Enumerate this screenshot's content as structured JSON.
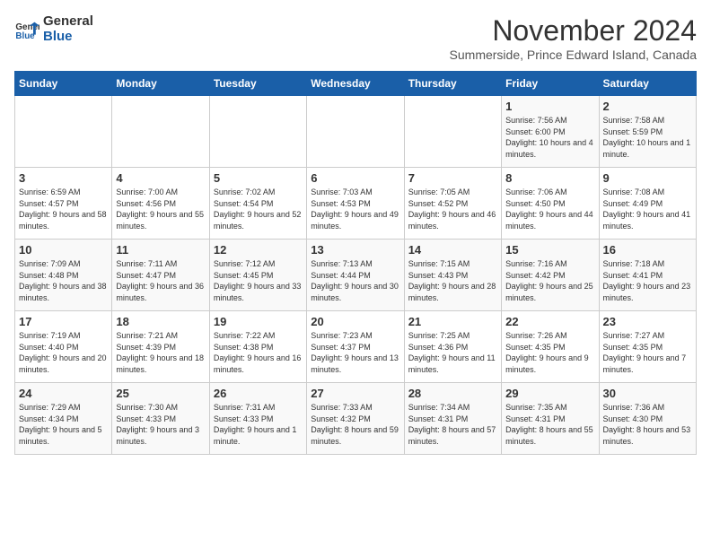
{
  "logo": {
    "line1": "General",
    "line2": "Blue"
  },
  "title": "November 2024",
  "subtitle": "Summerside, Prince Edward Island, Canada",
  "header": {
    "accent_color": "#1a5fa8"
  },
  "columns": [
    "Sunday",
    "Monday",
    "Tuesday",
    "Wednesday",
    "Thursday",
    "Friday",
    "Saturday"
  ],
  "weeks": [
    [
      {
        "day": "",
        "info": ""
      },
      {
        "day": "",
        "info": ""
      },
      {
        "day": "",
        "info": ""
      },
      {
        "day": "",
        "info": ""
      },
      {
        "day": "",
        "info": ""
      },
      {
        "day": "1",
        "info": "Sunrise: 7:56 AM\nSunset: 6:00 PM\nDaylight: 10 hours\nand 4 minutes."
      },
      {
        "day": "2",
        "info": "Sunrise: 7:58 AM\nSunset: 5:59 PM\nDaylight: 10 hours\nand 1 minute."
      }
    ],
    [
      {
        "day": "3",
        "info": "Sunrise: 6:59 AM\nSunset: 4:57 PM\nDaylight: 9 hours\nand 58 minutes."
      },
      {
        "day": "4",
        "info": "Sunrise: 7:00 AM\nSunset: 4:56 PM\nDaylight: 9 hours\nand 55 minutes."
      },
      {
        "day": "5",
        "info": "Sunrise: 7:02 AM\nSunset: 4:54 PM\nDaylight: 9 hours\nand 52 minutes."
      },
      {
        "day": "6",
        "info": "Sunrise: 7:03 AM\nSunset: 4:53 PM\nDaylight: 9 hours\nand 49 minutes."
      },
      {
        "day": "7",
        "info": "Sunrise: 7:05 AM\nSunset: 4:52 PM\nDaylight: 9 hours\nand 46 minutes."
      },
      {
        "day": "8",
        "info": "Sunrise: 7:06 AM\nSunset: 4:50 PM\nDaylight: 9 hours\nand 44 minutes."
      },
      {
        "day": "9",
        "info": "Sunrise: 7:08 AM\nSunset: 4:49 PM\nDaylight: 9 hours\nand 41 minutes."
      }
    ],
    [
      {
        "day": "10",
        "info": "Sunrise: 7:09 AM\nSunset: 4:48 PM\nDaylight: 9 hours\nand 38 minutes."
      },
      {
        "day": "11",
        "info": "Sunrise: 7:11 AM\nSunset: 4:47 PM\nDaylight: 9 hours\nand 36 minutes."
      },
      {
        "day": "12",
        "info": "Sunrise: 7:12 AM\nSunset: 4:45 PM\nDaylight: 9 hours\nand 33 minutes."
      },
      {
        "day": "13",
        "info": "Sunrise: 7:13 AM\nSunset: 4:44 PM\nDaylight: 9 hours\nand 30 minutes."
      },
      {
        "day": "14",
        "info": "Sunrise: 7:15 AM\nSunset: 4:43 PM\nDaylight: 9 hours\nand 28 minutes."
      },
      {
        "day": "15",
        "info": "Sunrise: 7:16 AM\nSunset: 4:42 PM\nDaylight: 9 hours\nand 25 minutes."
      },
      {
        "day": "16",
        "info": "Sunrise: 7:18 AM\nSunset: 4:41 PM\nDaylight: 9 hours\nand 23 minutes."
      }
    ],
    [
      {
        "day": "17",
        "info": "Sunrise: 7:19 AM\nSunset: 4:40 PM\nDaylight: 9 hours\nand 20 minutes."
      },
      {
        "day": "18",
        "info": "Sunrise: 7:21 AM\nSunset: 4:39 PM\nDaylight: 9 hours\nand 18 minutes."
      },
      {
        "day": "19",
        "info": "Sunrise: 7:22 AM\nSunset: 4:38 PM\nDaylight: 9 hours\nand 16 minutes."
      },
      {
        "day": "20",
        "info": "Sunrise: 7:23 AM\nSunset: 4:37 PM\nDaylight: 9 hours\nand 13 minutes."
      },
      {
        "day": "21",
        "info": "Sunrise: 7:25 AM\nSunset: 4:36 PM\nDaylight: 9 hours\nand 11 minutes."
      },
      {
        "day": "22",
        "info": "Sunrise: 7:26 AM\nSunset: 4:35 PM\nDaylight: 9 hours\nand 9 minutes."
      },
      {
        "day": "23",
        "info": "Sunrise: 7:27 AM\nSunset: 4:35 PM\nDaylight: 9 hours\nand 7 minutes."
      }
    ],
    [
      {
        "day": "24",
        "info": "Sunrise: 7:29 AM\nSunset: 4:34 PM\nDaylight: 9 hours\nand 5 minutes."
      },
      {
        "day": "25",
        "info": "Sunrise: 7:30 AM\nSunset: 4:33 PM\nDaylight: 9 hours\nand 3 minutes."
      },
      {
        "day": "26",
        "info": "Sunrise: 7:31 AM\nSunset: 4:33 PM\nDaylight: 9 hours\nand 1 minute."
      },
      {
        "day": "27",
        "info": "Sunrise: 7:33 AM\nSunset: 4:32 PM\nDaylight: 8 hours\nand 59 minutes."
      },
      {
        "day": "28",
        "info": "Sunrise: 7:34 AM\nSunset: 4:31 PM\nDaylight: 8 hours\nand 57 minutes."
      },
      {
        "day": "29",
        "info": "Sunrise: 7:35 AM\nSunset: 4:31 PM\nDaylight: 8 hours\nand 55 minutes."
      },
      {
        "day": "30",
        "info": "Sunrise: 7:36 AM\nSunset: 4:30 PM\nDaylight: 8 hours\nand 53 minutes."
      }
    ]
  ]
}
